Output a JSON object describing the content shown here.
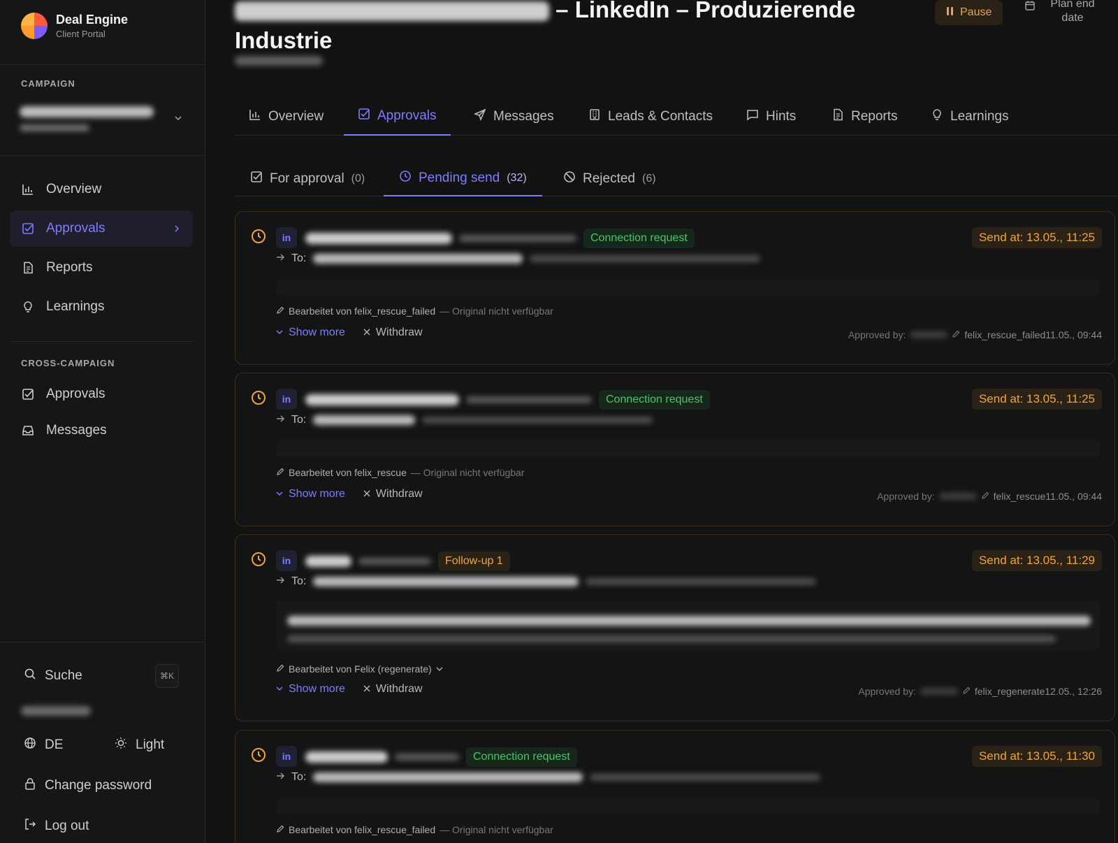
{
  "brand": {
    "title": "Deal Engine",
    "subtitle": "Client Portal"
  },
  "sidebar": {
    "campaign_label": "CAMPAIGN",
    "nav": [
      {
        "label": "Overview",
        "icon": "bar-chart-icon"
      },
      {
        "label": "Approvals",
        "icon": "check-square-icon"
      },
      {
        "label": "Reports",
        "icon": "document-icon"
      },
      {
        "label": "Learnings",
        "icon": "lightbulb-icon"
      }
    ],
    "cross_label": "CROSS-CAMPAIGN",
    "cross_nav": [
      {
        "label": "Approvals",
        "icon": "check-square-icon"
      },
      {
        "label": "Messages",
        "icon": "inbox-icon"
      }
    ],
    "search_label": "Suche",
    "search_shortcut": "⌘K",
    "language": "DE",
    "theme": "Light",
    "change_password": "Change password",
    "logout": "Log out"
  },
  "header": {
    "title": "– LinkedIn – Produzierende Industrie",
    "pause_label": "Pause",
    "plan_end_label": "Plan end date"
  },
  "tabs": [
    {
      "label": "Overview"
    },
    {
      "label": "Approvals"
    },
    {
      "label": "Messages"
    },
    {
      "label": "Leads & Contacts"
    },
    {
      "label": "Hints"
    },
    {
      "label": "Reports"
    },
    {
      "label": "Learnings"
    }
  ],
  "subtabs": [
    {
      "label": "For approval",
      "count": "(0)"
    },
    {
      "label": "Pending send",
      "count": "(32)"
    },
    {
      "label": "Rejected",
      "count": "(6)"
    }
  ],
  "labels": {
    "to": "To:",
    "show_more": "Show more",
    "withdraw": "Withdraw",
    "approved_by": "Approved by:"
  },
  "cards": [
    {
      "type_label": "Connection request",
      "send_at": "Send at: 13.05., 11:25",
      "edited_by": "Bearbeitet von felix_rescue_failed",
      "edited_note": "— Original nicht verfügbar",
      "approved_meta": "felix_rescue_failed11.05., 09:44"
    },
    {
      "type_label": "Connection request",
      "send_at": "Send at: 13.05., 11:25",
      "edited_by": "Bearbeitet von felix_rescue",
      "edited_note": "— Original nicht verfügbar",
      "approved_meta": "felix_rescue11.05., 09:44"
    },
    {
      "type_label": "Follow-up 1",
      "send_at": "Send at: 13.05., 11:29",
      "edited_by": "Bearbeitet von Felix (regenerate)",
      "edited_note": "",
      "approved_meta": "felix_regenerate12.05., 12:26"
    },
    {
      "type_label": "Connection request",
      "send_at": "Send at: 13.05., 11:30",
      "edited_by": "Bearbeitet von felix_rescue_failed",
      "edited_note": "— Original nicht verfügbar",
      "approved_meta": ""
    }
  ]
}
